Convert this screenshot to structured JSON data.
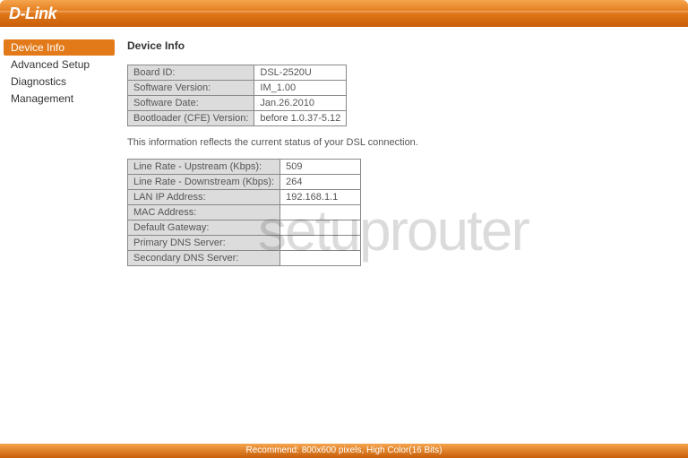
{
  "brand": "D-Link",
  "sidebar": {
    "items": [
      {
        "label": "Device Info",
        "active": true
      },
      {
        "label": "Advanced Setup",
        "active": false
      },
      {
        "label": "Diagnostics",
        "active": false
      },
      {
        "label": "Management",
        "active": false
      }
    ]
  },
  "main": {
    "title": "Device Info",
    "device_table": [
      {
        "label": "Board ID:",
        "value": "DSL-2520U"
      },
      {
        "label": "Software Version:",
        "value": "IM_1.00"
      },
      {
        "label": "Software Date:",
        "value": "Jan.26.2010"
      },
      {
        "label": "Bootloader (CFE) Version:",
        "value": "before 1.0.37-5.12"
      }
    ],
    "desc": "This information reflects the current status of your DSL connection.",
    "status_table": [
      {
        "label": "Line Rate - Upstream (Kbps):",
        "value": "509"
      },
      {
        "label": "Line Rate - Downstream (Kbps):",
        "value": "264"
      },
      {
        "label": "LAN IP Address:",
        "value": "192.168.1.1"
      },
      {
        "label": "MAC Address:",
        "value": ""
      },
      {
        "label": "Default Gateway:",
        "value": ""
      },
      {
        "label": "Primary DNS Server:",
        "value": ""
      },
      {
        "label": "Secondary DNS Server:",
        "value": ""
      }
    ]
  },
  "watermark": "setuprouter",
  "footer": "Recommend: 800x600 pixels, High Color(16 Bits)"
}
